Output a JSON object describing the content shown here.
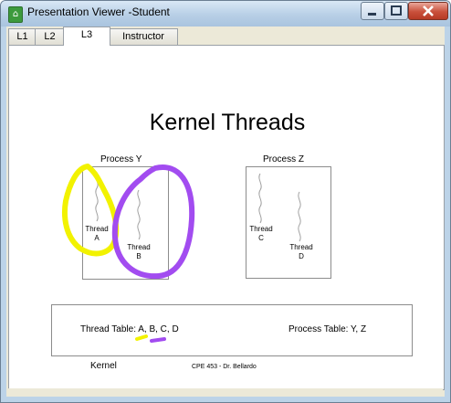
{
  "window": {
    "title": "Presentation Viewer -Student"
  },
  "tabs": [
    {
      "label": "L1"
    },
    {
      "label": "L2"
    },
    {
      "label": "L3"
    },
    {
      "label": "Instructor"
    }
  ],
  "slide": {
    "title": "Kernel Threads",
    "process_y": "Process Y",
    "process_z": "Process Z",
    "threads": {
      "a": [
        "Thread",
        "A"
      ],
      "b": [
        "Thread",
        "B"
      ],
      "c": [
        "Thread",
        "C"
      ],
      "d": [
        "Thread",
        "D"
      ]
    },
    "kernel": {
      "thread_table_prefix": "Thread Table: ",
      "thread_table_items": [
        "A",
        "B",
        "C",
        "D"
      ],
      "process_table": "Process Table: Y, Z",
      "label": "Kernel"
    },
    "footer": "CPE 453 - Dr. Bellardo"
  },
  "annotations": {
    "yellow": "#f2f200",
    "purple": "#a24cf0"
  }
}
